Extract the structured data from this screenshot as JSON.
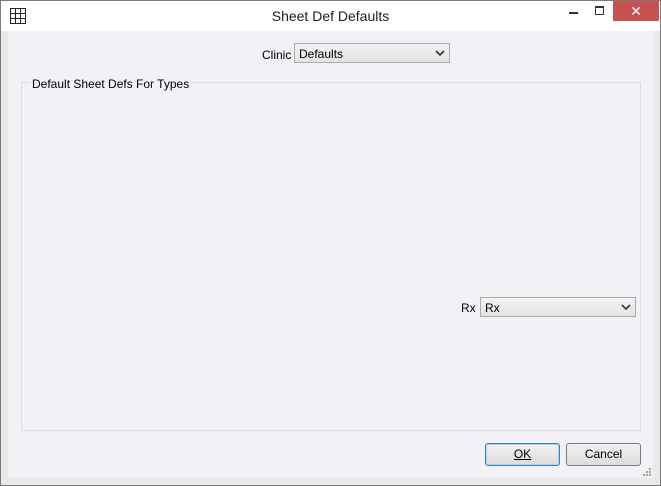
{
  "window": {
    "title": "Sheet Def Defaults",
    "close_glyph": "✕"
  },
  "clinic": {
    "label": "Clinic",
    "selected": "Defaults"
  },
  "group": {
    "legend": "Default Sheet Defs For Types",
    "rows": [
      {
        "label": "Rx",
        "selected": "Rx"
      }
    ]
  },
  "buttons": {
    "ok": "OK",
    "cancel": "Cancel"
  },
  "colors": {
    "close_button": "#c75050",
    "client_background": "#f3f1f5",
    "default_button_border": "#3c7fb1"
  },
  "icons": [
    "grid-icon",
    "minimize-icon",
    "maximize-icon",
    "close-icon",
    "chevron-down-icon",
    "resize-grip-icon"
  ]
}
